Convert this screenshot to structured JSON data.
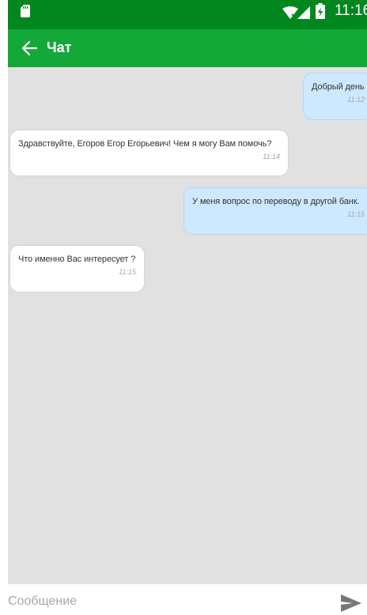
{
  "status_bar": {
    "time": "11:16",
    "icons": [
      "sim-card-icon",
      "wifi-icon",
      "signal-icon",
      "battery-charging-icon"
    ]
  },
  "app_bar": {
    "title": "Чат",
    "back_icon": "arrow-left-icon",
    "background": "#13a838",
    "status_background": "#02871e"
  },
  "chat": {
    "messages": [
      {
        "direction": "outgoing",
        "text": "Добрый день",
        "time": "11:12"
      },
      {
        "direction": "incoming",
        "text": "Здравствуйте, Егоров Егор Егорьевич! Чем я могу Вам помочь?",
        "time": "11:14"
      },
      {
        "direction": "outgoing",
        "text": "У меня вопрос по переводу в другой банк.",
        "time": "11:15"
      },
      {
        "direction": "incoming",
        "text": "Что именно Вас интересует ?",
        "time": "11:15"
      }
    ],
    "background": "#e1e1e1",
    "outgoing_bubble": "#cce9ff",
    "incoming_bubble": "#ffffff"
  },
  "composer": {
    "placeholder": "Сообщение",
    "value": "",
    "send_icon": "send-icon"
  }
}
